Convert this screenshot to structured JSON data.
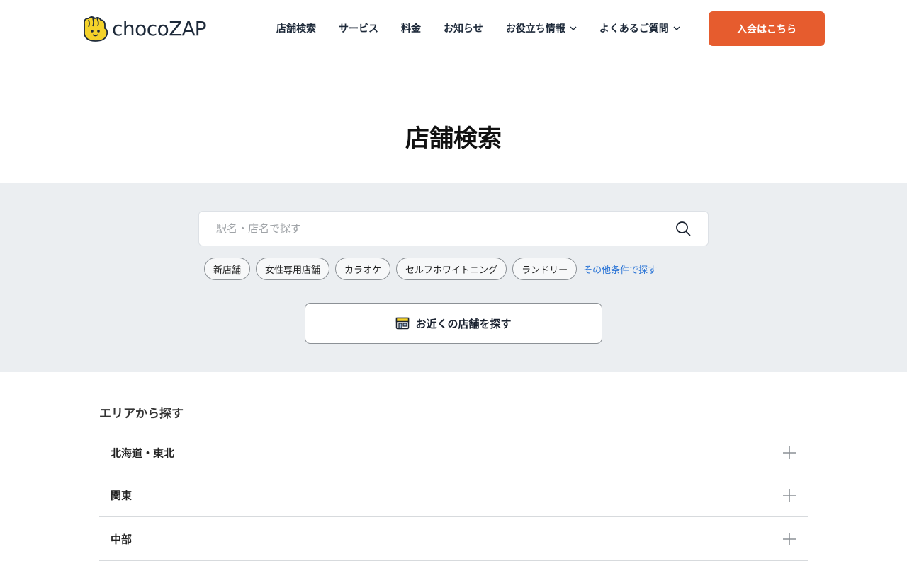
{
  "brand": {
    "logo_text_a": "choco",
    "logo_text_b": "ZAP",
    "colors": {
      "accent": "#e65c2e",
      "logo_yellow": "#f4d22a",
      "link": "#2a74d6",
      "band": "#ebeef1"
    }
  },
  "nav": {
    "items": [
      {
        "label": "店舗検索"
      },
      {
        "label": "サービス"
      },
      {
        "label": "料金"
      },
      {
        "label": "お知らせ"
      },
      {
        "label": "お役立ち情報",
        "icon": "chevron-down-icon"
      },
      {
        "label": "よくあるご質問",
        "icon": "chevron-down-icon"
      }
    ],
    "cta_label": "入会はこちら"
  },
  "page": {
    "title": "店舗検索"
  },
  "search": {
    "placeholder": "駅名・店名で探す",
    "icon": "search-icon",
    "chips": [
      "新店舗",
      "女性専用店舗",
      "カラオケ",
      "セルフホワイトニング",
      "ランドリー"
    ],
    "more_link": "その他条件で探す",
    "nearby_label": "お近くの店舗を探す",
    "nearby_icon": "store-icon"
  },
  "area": {
    "title": "エリアから探す",
    "items": [
      "北海道・東北",
      "関東",
      "中部"
    ],
    "expand_icon": "plus-icon"
  }
}
